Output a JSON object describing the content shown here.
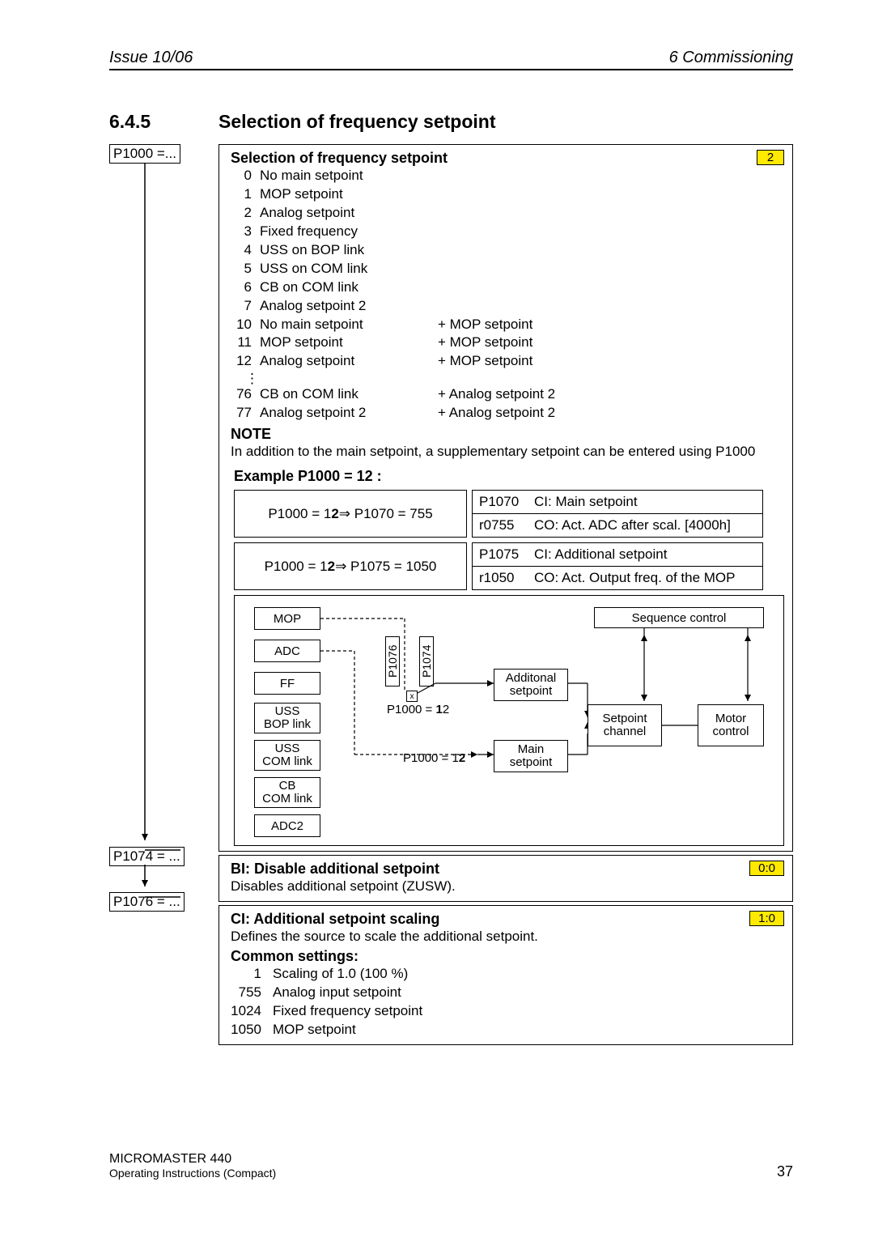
{
  "header": {
    "left": "Issue 10/06",
    "right": "6  Commissioning"
  },
  "section": {
    "num": "6.4.5",
    "title": "Selection of frequency setpoint"
  },
  "p1000": {
    "tag": "P1000 =...",
    "title": "Selection of frequency setpoint",
    "badge": "2",
    "list1": [
      {
        "n": "0",
        "l": "No main setpoint"
      },
      {
        "n": "1",
        "l": "MOP setpoint"
      },
      {
        "n": "2",
        "l": "Analog setpoint"
      },
      {
        "n": "3",
        "l": "Fixed frequency"
      },
      {
        "n": "4",
        "l": "USS on BOP link"
      },
      {
        "n": "5",
        "l": "USS on COM link"
      },
      {
        "n": "6",
        "l": "CB on COM link"
      },
      {
        "n": "7",
        "l": "Analog setpoint 2"
      }
    ],
    "list2": [
      {
        "n": "10",
        "l": "No main setpoint",
        "e": "+  MOP setpoint"
      },
      {
        "n": "11",
        "l": "MOP setpoint",
        "e": "+  MOP setpoint"
      },
      {
        "n": "12",
        "l": "Analog setpoint",
        "e": "+  MOP setpoint"
      }
    ],
    "list3": [
      {
        "n": "76",
        "l": "CB on COM link",
        "e": "+  Analog setpoint 2"
      },
      {
        "n": "77",
        "l": "Analog setpoint 2",
        "e": "+  Analog setpoint 2"
      }
    ],
    "note_title": "NOTE",
    "note_text": "In addition to the main setpoint, a supplementary setpoint can be entered using P1000",
    "example_title": "Example P1000 = 12 :",
    "ex1": {
      "left_a": "P1000 = 1",
      "left_b": "2",
      "left_c": "  ⇒  P1070 = 755",
      "r1c": "P1070",
      "r1t": "CI: Main setpoint",
      "r2c": "r0755",
      "r2t": "CO: Act. ADC after scal. [4000h]"
    },
    "ex2": {
      "left_a": "P1000 = 1",
      "left_b": "2",
      "left_c": "  ⇒  P1075 = 1050",
      "r1c": "P1075",
      "r1t": "CI: Additional setpoint",
      "r2c": "r1050",
      "r2t": "CO: Act. Output freq. of the MOP"
    },
    "diagram": {
      "sources": [
        "MOP",
        "ADC",
        "FF",
        "USS\nBOP link",
        "USS\nCOM link",
        "CB\nCOM link",
        "ADC2"
      ],
      "p_vert1": "P1076",
      "p_vert2": "P1074",
      "sp_add": "Additonal\nsetpoint",
      "sp_main": "Main\nsetpoint",
      "seq": "Sequence control",
      "sc": "Setpoint\nchannel",
      "mc": "Motor\ncontrol",
      "sw": "x",
      "plabel1_a": "P1000 = ",
      "plabel1_b": "1",
      "plabel1_c": "2",
      "plabel2_a": "P1000 = 1",
      "plabel2_b": "2"
    }
  },
  "p1074": {
    "tag": "P1074 = ...",
    "title": "BI: Disable additional setpoint",
    "badge": "0:0",
    "desc": "Disables additional setpoint (ZUSW)."
  },
  "p1076": {
    "tag": "P1076 = ...",
    "title": "CI: Additional setpoint scaling",
    "badge": "1:0",
    "desc": "Defines the source to scale the additional setpoint.",
    "common_title": "Common settings:",
    "list": [
      {
        "n": "1",
        "l": "Scaling of 1.0 (100 %)"
      },
      {
        "n": "755",
        "l": "Analog input setpoint"
      },
      {
        "n": "1024",
        "l": "Fixed frequency setpoint"
      },
      {
        "n": "1050",
        "l": "MOP setpoint"
      }
    ]
  },
  "footer": {
    "l1": "MICROMASTER 440",
    "l2": "Operating Instructions (Compact)",
    "page": "37"
  }
}
